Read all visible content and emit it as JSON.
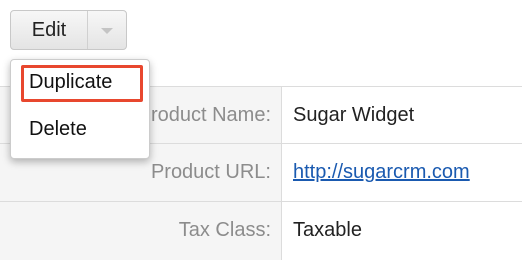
{
  "toolbar": {
    "edit_label": "Edit",
    "toggle_icon": "chevron-down-icon"
  },
  "dropdown": {
    "items": [
      {
        "label": "Duplicate",
        "highlighted": true
      },
      {
        "label": "Delete",
        "highlighted": false
      }
    ],
    "highlight_color": "#e8472e"
  },
  "details": {
    "rows": [
      {
        "label": "Product Name:",
        "value": "Sugar Widget",
        "is_link": false
      },
      {
        "label": "Product URL:",
        "value": "http://sugarcrm.com",
        "is_link": true
      },
      {
        "label": "Tax Class:",
        "value": "Taxable",
        "is_link": false
      }
    ]
  },
  "colors": {
    "link": "#1a5ab0",
    "label_text": "#8c8c8c",
    "label_background": "#f5f5f5"
  }
}
